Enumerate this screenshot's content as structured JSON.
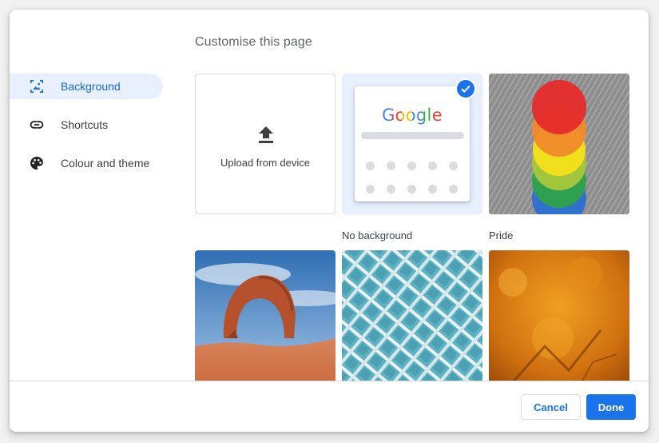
{
  "dialog": {
    "title": "Customise this page"
  },
  "nav": {
    "items": [
      {
        "label": "Background",
        "icon": "background-icon",
        "selected": true
      },
      {
        "label": "Shortcuts",
        "icon": "link-icon",
        "selected": false
      },
      {
        "label": "Colour and theme",
        "icon": "palette-icon",
        "selected": false
      }
    ]
  },
  "tiles": {
    "upload": {
      "label": "Upload from device",
      "icon": "upload-icon"
    },
    "no_background": {
      "label": "No background",
      "logo": "Google",
      "selected": true
    },
    "pride": {
      "label": "Pride"
    },
    "arch": {
      "label": ""
    },
    "glass": {
      "label": ""
    },
    "autumn": {
      "label": ""
    }
  },
  "footer": {
    "cancel_label": "Cancel",
    "done_label": "Done"
  },
  "colors": {
    "accent": "#1a73e8",
    "selected_nav_bg": "#e8f0fe",
    "text": "#3c4043",
    "border": "#dadce0"
  }
}
